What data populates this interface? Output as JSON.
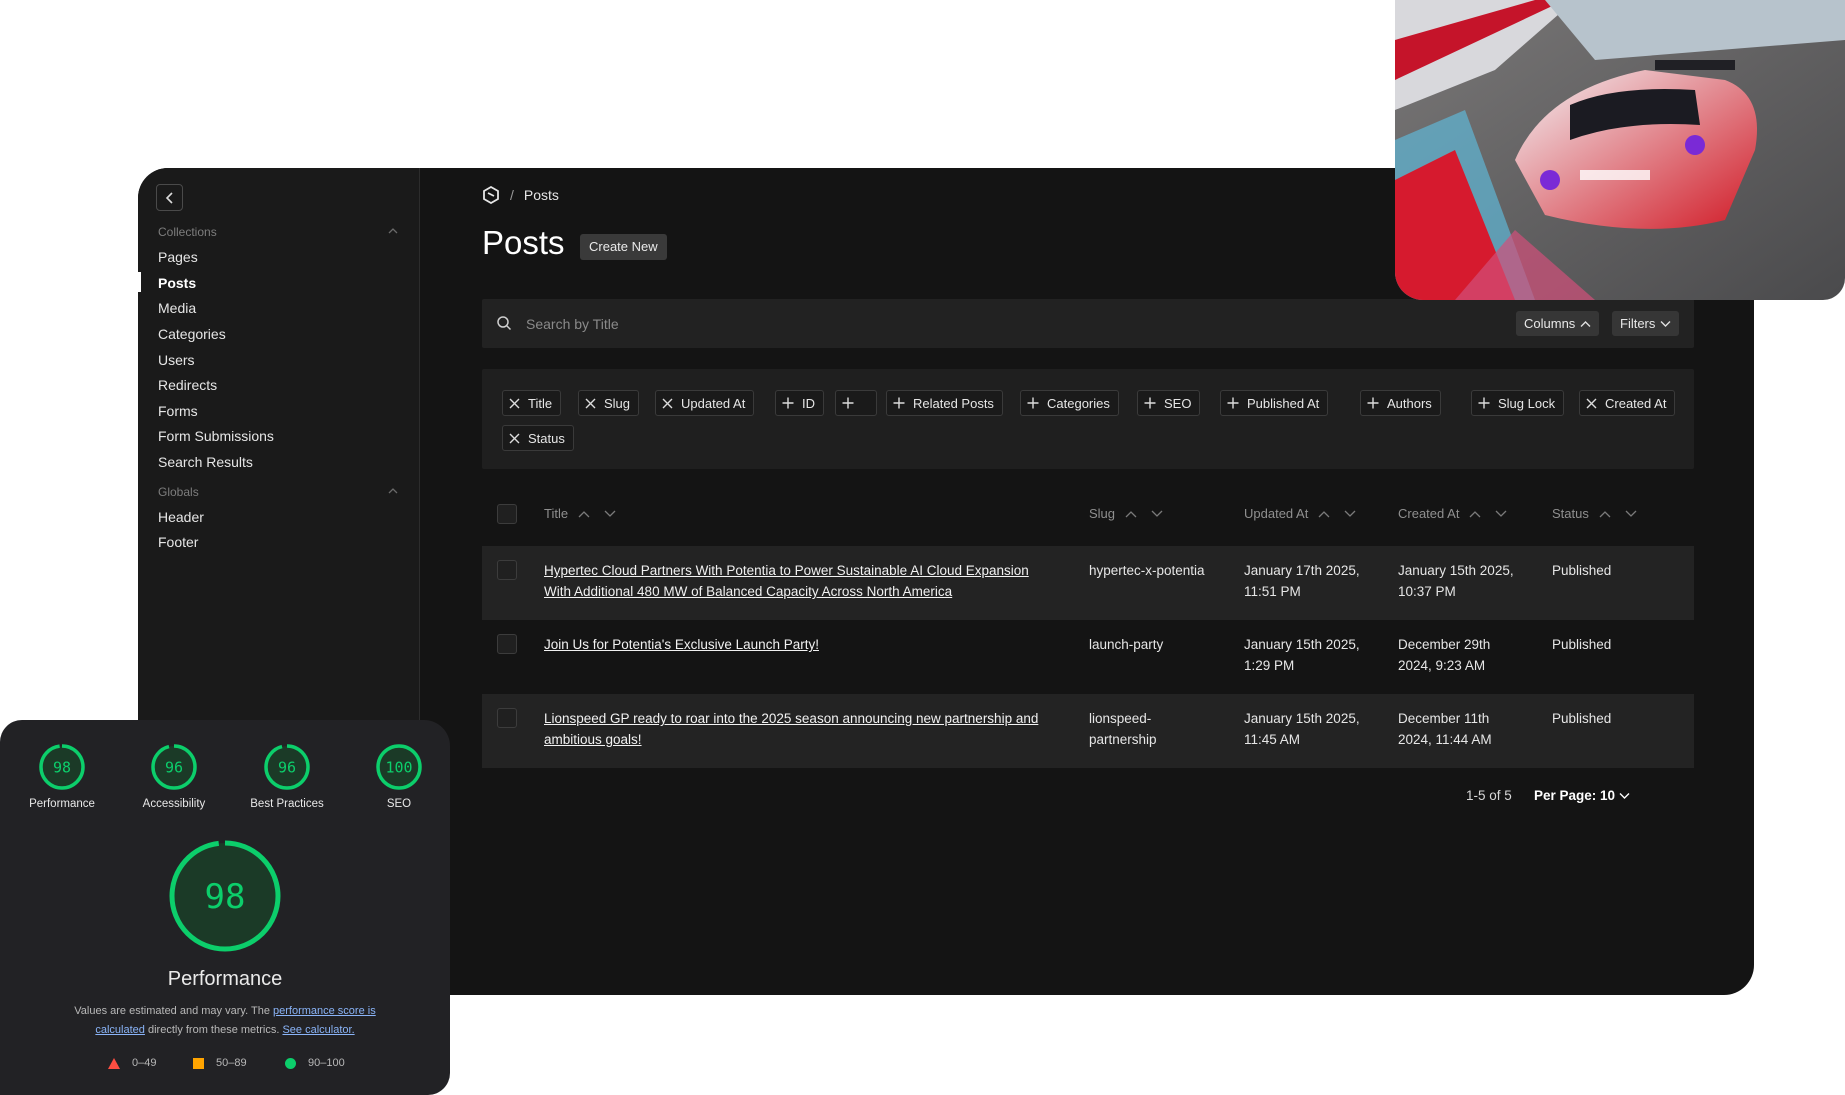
{
  "sidebar": {
    "groups": [
      {
        "label": "Collections",
        "items": [
          "Pages",
          "Posts",
          "Media",
          "Categories",
          "Users",
          "Redirects",
          "Forms",
          "Form Submissions",
          "Search Results"
        ]
      },
      {
        "label": "Globals",
        "items": [
          "Header",
          "Footer"
        ]
      }
    ],
    "active_item": "Posts"
  },
  "breadcrumb": {
    "separator": "/",
    "current": "Posts"
  },
  "header": {
    "title": "Posts",
    "create_label": "Create New"
  },
  "search": {
    "placeholder": "Search by Title",
    "columns_label": "Columns",
    "filters_label": "Filters"
  },
  "column_pills": [
    {
      "label": "Title",
      "icon": "close-icon"
    },
    {
      "label": "Slug",
      "icon": "close-icon"
    },
    {
      "label": "Updated At",
      "icon": "close-icon"
    },
    {
      "label": "ID",
      "icon": "plus-icon"
    },
    {
      "label": "",
      "icon": "plus-icon"
    },
    {
      "label": "Related Posts",
      "icon": "plus-icon"
    },
    {
      "label": "Categories",
      "icon": "plus-icon"
    },
    {
      "label": "SEO",
      "icon": "plus-icon"
    },
    {
      "label": "Published At",
      "icon": "plus-icon"
    },
    {
      "label": "Authors",
      "icon": "plus-icon"
    },
    {
      "label": "Slug Lock",
      "icon": "plus-icon"
    },
    {
      "label": "Created At",
      "icon": "close-icon"
    },
    {
      "label": "Status",
      "icon": "close-icon"
    }
  ],
  "table": {
    "headers": [
      "Title",
      "Slug",
      "Updated At",
      "Created At",
      "Status"
    ],
    "rows": [
      {
        "title": [
          "Hypertec Cloud Partners With Potentia to Power Sustainable AI Cloud Expansion",
          "With Additional 480 MW of Balanced Capacity Across North America"
        ],
        "slug": [
          "hypertec-x-potentia"
        ],
        "updated": [
          "January 17th 2025,",
          "11:51 PM"
        ],
        "created": [
          "January 15th 2025,",
          "10:37 PM"
        ],
        "status": "Published"
      },
      {
        "title": [
          "Join Us for Potentia's Exclusive Launch Party!"
        ],
        "slug": [
          "launch-party"
        ],
        "updated": [
          "January 15th 2025,",
          "1:29 PM"
        ],
        "created": [
          "December 29th",
          "2024, 9:23 AM"
        ],
        "status": "Published"
      },
      {
        "title": [
          "Lionspeed GP ready to roar into the 2025 season announcing new partnership and",
          "ambitious goals!"
        ],
        "slug": [
          "lionspeed-",
          "partnership"
        ],
        "updated": [
          "January 15th 2025,",
          "11:45 AM"
        ],
        "created": [
          "December 11th",
          "2024, 11:44 AM"
        ],
        "status": "Published"
      }
    ]
  },
  "pagination": {
    "range": "1-5 of 5",
    "per_page": "Per Page: 10"
  },
  "lighthouse": {
    "scores": [
      {
        "label": "Performance",
        "value": "98",
        "fraction": 0.98
      },
      {
        "label": "Accessibility",
        "value": "96",
        "fraction": 0.96
      },
      {
        "label": "Best Practices",
        "value": "96",
        "fraction": 0.96
      },
      {
        "label": "SEO",
        "value": "100",
        "fraction": 1.0
      }
    ],
    "main": {
      "label": "Performance",
      "value": "98",
      "fraction": 0.98
    },
    "note": {
      "pre": "Values are estimated and may vary. The ",
      "link1": "performance score is calculated",
      "mid": " directly from these metrics. ",
      "link2": "See calculator."
    },
    "legend": [
      "0–49",
      "50–89",
      "90–100"
    ],
    "colors": {
      "good": "#0cce6b",
      "average": "#ffa400",
      "poor": "#ff4e42"
    }
  }
}
